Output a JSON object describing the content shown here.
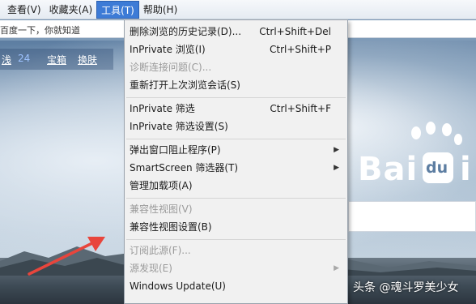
{
  "menubar": {
    "items": [
      {
        "label": "查看(V)"
      },
      {
        "label": "收藏夹(A)"
      },
      {
        "label": "工具(T)"
      },
      {
        "label": "帮助(H)"
      }
    ]
  },
  "addressbar": {
    "text": "百度一下，你就知道"
  },
  "links": {
    "partial": "浅",
    "count": "24",
    "treasure": "宝箱",
    "skin": "换肤"
  },
  "logo": {
    "left": "Bai",
    "du": "du",
    "right": "i"
  },
  "tools_menu": {
    "items": [
      {
        "label": "删除浏览的历史记录(D)...",
        "shortcut": "Ctrl+Shift+Del",
        "enabled": true
      },
      {
        "label": "InPrivate 浏览(I)",
        "shortcut": "Ctrl+Shift+P",
        "enabled": true
      },
      {
        "label": "诊断连接问题(C)...",
        "shortcut": "",
        "enabled": false
      },
      {
        "label": "重新打开上次浏览会话(S)",
        "shortcut": "",
        "enabled": true
      },
      {
        "label": "InPrivate 筛选",
        "shortcut": "Ctrl+Shift+F",
        "enabled": true
      },
      {
        "label": "InPrivate 筛选设置(S)",
        "shortcut": "",
        "enabled": true
      },
      {
        "label": "弹出窗口阻止程序(P)",
        "shortcut": "",
        "enabled": true,
        "submenu": true
      },
      {
        "label": "SmartScreen 筛选器(T)",
        "shortcut": "",
        "enabled": true,
        "submenu": true
      },
      {
        "label": "管理加载项(A)",
        "shortcut": "",
        "enabled": true
      },
      {
        "label": "兼容性视图(V)",
        "shortcut": "",
        "enabled": false
      },
      {
        "label": "兼容性视图设置(B)",
        "shortcut": "",
        "enabled": true
      },
      {
        "label": "订阅此源(F)...",
        "shortcut": "",
        "enabled": false
      },
      {
        "label": "源发现(E)",
        "shortcut": "",
        "enabled": false,
        "submenu": true
      },
      {
        "label": "Windows Update(U)",
        "shortcut": "",
        "enabled": true
      }
    ]
  },
  "watermark": "头条 @魂斗罗美少女",
  "colors": {
    "menu_active": "#3d7bd6",
    "menu_bg": "#f1f1f1",
    "arrow": "#e8453c",
    "disabled_text": "#9a9a9a"
  }
}
